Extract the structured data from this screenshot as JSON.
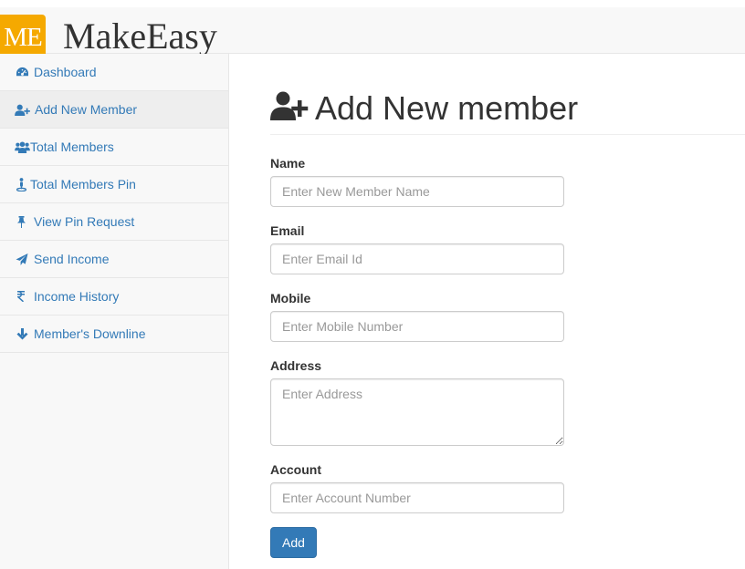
{
  "header": {
    "logo_text": "ME",
    "brand": "MakeEasy",
    "logo_color": "#f5a900"
  },
  "sidebar": {
    "items": [
      {
        "label": "Dashboard",
        "icon": "dashboard-icon"
      },
      {
        "label": "Add New Member",
        "icon": "user-plus-icon",
        "active": true
      },
      {
        "label": "Total Members",
        "icon": "users-icon"
      },
      {
        "label": "Total Members Pin",
        "icon": "pin-person-icon"
      },
      {
        "label": "View Pin Request",
        "icon": "pushpin-icon"
      },
      {
        "label": "Send Income",
        "icon": "send-icon"
      },
      {
        "label": "Income History",
        "icon": "rupee-icon"
      },
      {
        "label": "Member's Downline",
        "icon": "arrow-down-icon"
      }
    ],
    "link_color": "#337ab7"
  },
  "main": {
    "title": "Add New member",
    "title_icon": "user-plus-icon",
    "form": {
      "name": {
        "label": "Name",
        "placeholder": "Enter New Member Name"
      },
      "email": {
        "label": "Email",
        "placeholder": "Enter Email Id"
      },
      "mobile": {
        "label": "Mobile",
        "placeholder": "Enter Mobile Number"
      },
      "address": {
        "label": "Address",
        "placeholder": "Enter Address"
      },
      "account": {
        "label": "Account",
        "placeholder": "Enter Account Number"
      },
      "submit_label": "Add"
    },
    "button_color": "#337ab7"
  }
}
